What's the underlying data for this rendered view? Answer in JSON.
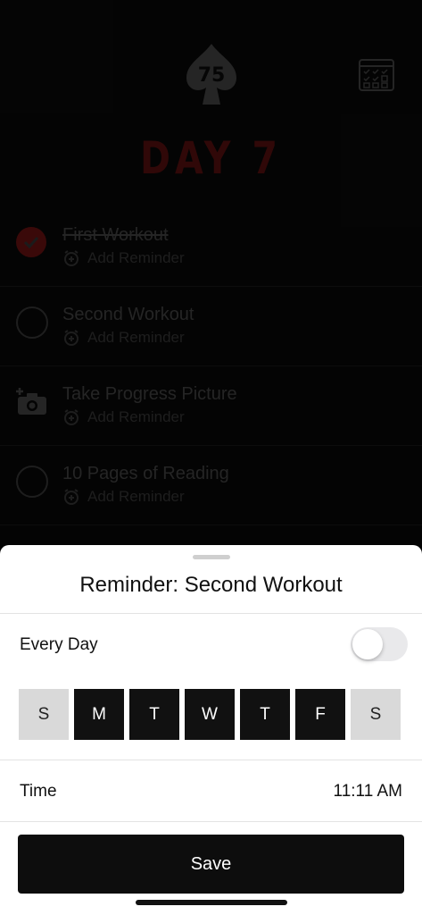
{
  "app": {
    "logo_text": "75",
    "day_title": "DAY 7",
    "tasks": [
      {
        "title": "First Workout",
        "reminder": "Add Reminder",
        "done": true,
        "lead": "check-filled"
      },
      {
        "title": "Second Workout",
        "reminder": "Add Reminder",
        "done": false,
        "lead": "circle"
      },
      {
        "title": "Take Progress Picture",
        "reminder": "Add Reminder",
        "done": false,
        "lead": "camera-plus"
      },
      {
        "title": "10 Pages of Reading",
        "reminder": "Add Reminder",
        "done": false,
        "lead": "circle"
      }
    ]
  },
  "sheet": {
    "title": "Reminder: Second Workout",
    "every_day_label": "Every Day",
    "every_day_on": false,
    "days": [
      {
        "label": "S",
        "selected": false
      },
      {
        "label": "M",
        "selected": true
      },
      {
        "label": "T",
        "selected": true
      },
      {
        "label": "W",
        "selected": true
      },
      {
        "label": "T",
        "selected": true
      },
      {
        "label": "F",
        "selected": true
      },
      {
        "label": "S",
        "selected": false
      }
    ],
    "time_label": "Time",
    "time_value": "11:11 AM",
    "save_label": "Save"
  },
  "colors": {
    "accent_dim": "#4b0d0d",
    "sheet_bg": "#ffffff",
    "button_bg": "#0d0d0d"
  }
}
